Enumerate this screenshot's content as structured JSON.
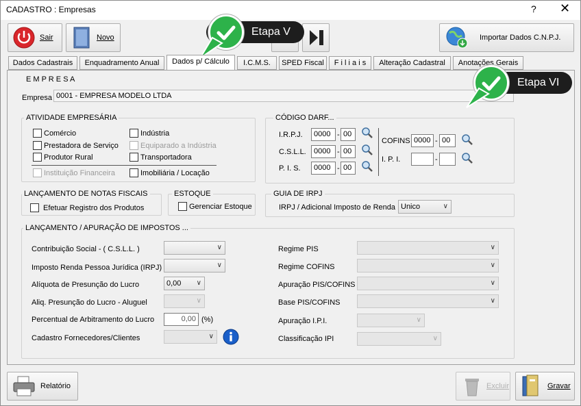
{
  "window": {
    "title": "CADASTRO : Empresas",
    "help": "?",
    "close": "✕"
  },
  "toolbar": {
    "exit_label": "Sair",
    "new_label": "Novo",
    "import_label": "Importar Dados C.N.P.J."
  },
  "tabs": [
    {
      "label": "Dados Cadastrais"
    },
    {
      "label": "Enquadramento Anual"
    },
    {
      "label": "Dados p/ Cálculo"
    },
    {
      "label": "I.C.M.S."
    },
    {
      "label": "SPED Fiscal"
    },
    {
      "label": "F i l i a i s"
    },
    {
      "label": "Alteração Cadastral"
    },
    {
      "label": "Anotações Gerais"
    }
  ],
  "callouts": {
    "etapa5": "Etapa V",
    "etapa6": "Etapa VI"
  },
  "empresa": {
    "section": "E M P R E S A",
    "label": "Empresa",
    "value": "0001 - EMPRESA MODELO LTDA"
  },
  "atividade": {
    "title": "ATIVIDADE EMPRESÁRIA",
    "items": [
      {
        "label": "Comércio"
      },
      {
        "label": "Indústria"
      },
      {
        "label": "Prestadora de Serviço"
      },
      {
        "label": "Equiparado a Indústria"
      },
      {
        "label": "Produtor Rural"
      },
      {
        "label": "Transportadora"
      },
      {
        "label": "Instituição Financeira"
      },
      {
        "label": "Imobiliária / Locação"
      }
    ]
  },
  "darf": {
    "title": "CÓDIGO DARF...",
    "rows": [
      {
        "label": "I.R.P.J.",
        "code": "0000",
        "var": "00"
      },
      {
        "label": "C.S.L.L.",
        "code": "0000",
        "var": "00"
      },
      {
        "label": "P. I. S.",
        "code": "0000",
        "var": "00"
      }
    ],
    "cofins": {
      "label": "COFINS",
      "code": "0000",
      "var": "00"
    },
    "ipi": {
      "label": "I. P. I.",
      "code": "",
      "var": ""
    },
    "sep": "-"
  },
  "notas": {
    "title": "LANÇAMENTO DE NOTAS FISCAIS",
    "check": "Efetuar Registro dos Produtos"
  },
  "estoque": {
    "title": "ESTOQUE",
    "check": "Gerenciar Estoque"
  },
  "guia": {
    "title": "GUIA DE IRPJ",
    "label": "IRPJ / Adicional Imposto de Renda",
    "value": "Unico"
  },
  "lancamento": {
    "title": "LANÇAMENTO / APURAÇÃO DE IMPOSTOS ...",
    "left": [
      {
        "label": "Contribuição Social - ( C.S.L.L. )",
        "value": ""
      },
      {
        "label": "Imposto Renda Pessoa Jurídica (IRPJ)",
        "value": ""
      },
      {
        "label": "Alíquota de Presunção do Lucro",
        "value": "0,00"
      },
      {
        "label": "Aliq. Presunção do Lucro - Aluguel",
        "value": ""
      },
      {
        "label": "Percentual de Arbitramento do Lucro",
        "value": "0,00"
      },
      {
        "label": "Cadastro Fornecedores/Clientes",
        "value": ""
      }
    ],
    "pct": "(%)",
    "right": [
      {
        "label": "Regime PIS",
        "value": ""
      },
      {
        "label": "Regime COFINS",
        "value": ""
      },
      {
        "label": "Apuração PIS/COFINS",
        "value": ""
      },
      {
        "label": "Base PIS/COFINS",
        "value": ""
      },
      {
        "label": "Apuração I.P.I.",
        "value": ""
      },
      {
        "label": "Classificação IPI",
        "value": ""
      }
    ]
  },
  "footer": {
    "report_label": "Relatório",
    "delete_label": "Excluir",
    "save_label": "Gravar"
  }
}
